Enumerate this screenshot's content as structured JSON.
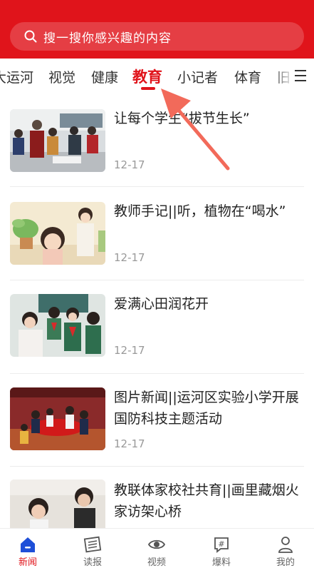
{
  "search": {
    "placeholder": "搜一搜你感兴趣的内容"
  },
  "tabs": [
    "大运河",
    "视觉",
    "健康",
    "教育",
    "小记者",
    "体育",
    "旧"
  ],
  "active_tab": "教育",
  "articles": [
    {
      "title": "让每个学生“拔节生长”",
      "date": "12-17"
    },
    {
      "title": "教师手记||听，植物在“喝水”",
      "date": "12-17"
    },
    {
      "title": "爱满心田润花开",
      "date": "12-17"
    },
    {
      "title": "图片新闻||运河区实验小学开展国防科技主题活动",
      "date": "12-17"
    },
    {
      "title": "教联体家校社共育||画里藏烟火 家访架心桥",
      "date": ""
    }
  ],
  "tabbar": [
    {
      "label": "新闻",
      "icon": "home-icon"
    },
    {
      "label": "读报",
      "icon": "newspaper-icon"
    },
    {
      "label": "视频",
      "icon": "eye-icon"
    },
    {
      "label": "爆料",
      "icon": "hashtag-chat-icon"
    },
    {
      "label": "我的",
      "icon": "user-icon"
    }
  ],
  "colors": {
    "brand": "#e0141b",
    "text": "#222222",
    "muted": "#999999"
  }
}
